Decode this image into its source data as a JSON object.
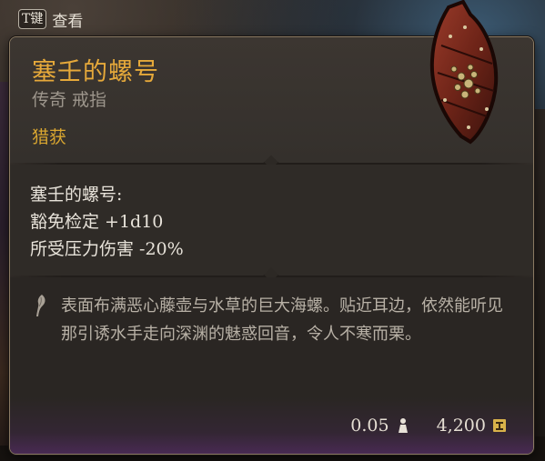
{
  "hint": {
    "key": "T键",
    "label": "查看"
  },
  "item": {
    "name": "塞壬的螺号",
    "type": "传奇 戒指",
    "tag": "猎获",
    "name_color": "#e6a93a",
    "tag_color": "#d9a630"
  },
  "effects": {
    "header": "塞壬的螺号:",
    "lines": [
      "豁免检定 +1d10",
      "所受压力伤害 -20%"
    ]
  },
  "lore": {
    "icon": "quill-icon",
    "text": "表面布满恶心藤壶与水草的巨大海螺。贴近耳边，依然能听见那引诱水手走向深渊的魅惑回音，令人不寒而栗。"
  },
  "footer": {
    "weight": "0.05",
    "weight_icon": "weight-icon",
    "price": "4,200",
    "price_icon": "gold-coin-icon"
  }
}
